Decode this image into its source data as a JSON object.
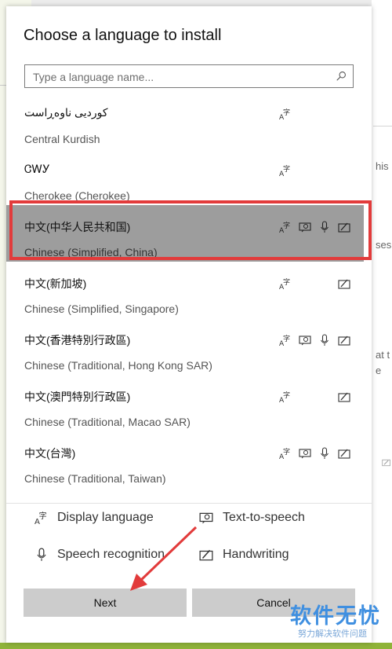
{
  "dialog": {
    "title": "Choose a language to install",
    "search_placeholder": "Type a language name..."
  },
  "languages": [
    {
      "native": "کوردیی ناوەڕاست",
      "english": "Central Kurdish",
      "features": [
        "display-language"
      ],
      "selected": false
    },
    {
      "native": "ᏣᎳᎩ",
      "english": "Cherokee (Cherokee)",
      "features": [
        "display-language"
      ],
      "selected": false
    },
    {
      "native": "中文(中华人民共和国)",
      "english": "Chinese (Simplified, China)",
      "features": [
        "display-language",
        "text-to-speech",
        "speech-recognition",
        "handwriting"
      ],
      "selected": true
    },
    {
      "native": "中文(新加坡)",
      "english": "Chinese (Simplified, Singapore)",
      "features": [
        "display-language",
        "handwriting"
      ],
      "selected": false
    },
    {
      "native": "中文(香港特別行政區)",
      "english": "Chinese (Traditional, Hong Kong SAR)",
      "features": [
        "display-language",
        "text-to-speech",
        "speech-recognition",
        "handwriting"
      ],
      "selected": false
    },
    {
      "native": "中文(澳門特別行政區)",
      "english": "Chinese (Traditional, Macao SAR)",
      "features": [
        "display-language",
        "handwriting"
      ],
      "selected": false
    },
    {
      "native": "中文(台灣)",
      "english": "Chinese (Traditional, Taiwan)",
      "features": [
        "display-language",
        "text-to-speech",
        "speech-recognition",
        "handwriting"
      ],
      "selected": false
    }
  ],
  "legend": {
    "display_language": "Display language",
    "text_to_speech": "Text-to-speech",
    "speech_recognition": "Speech recognition",
    "handwriting": "Handwriting"
  },
  "buttons": {
    "next": "Next",
    "cancel": "Cancel"
  },
  "background": {
    "fragment_1": "his",
    "fragment_2": "ses",
    "fragment_3": "at t",
    "fragment_4": "e"
  },
  "watermark": {
    "title": "软件无忧",
    "subtitle": "努力解决软件问题"
  },
  "colors": {
    "selected_row": "#9d9d9d",
    "annotation_red": "#e23b3b",
    "watermark_blue": "#3f8fe0"
  }
}
